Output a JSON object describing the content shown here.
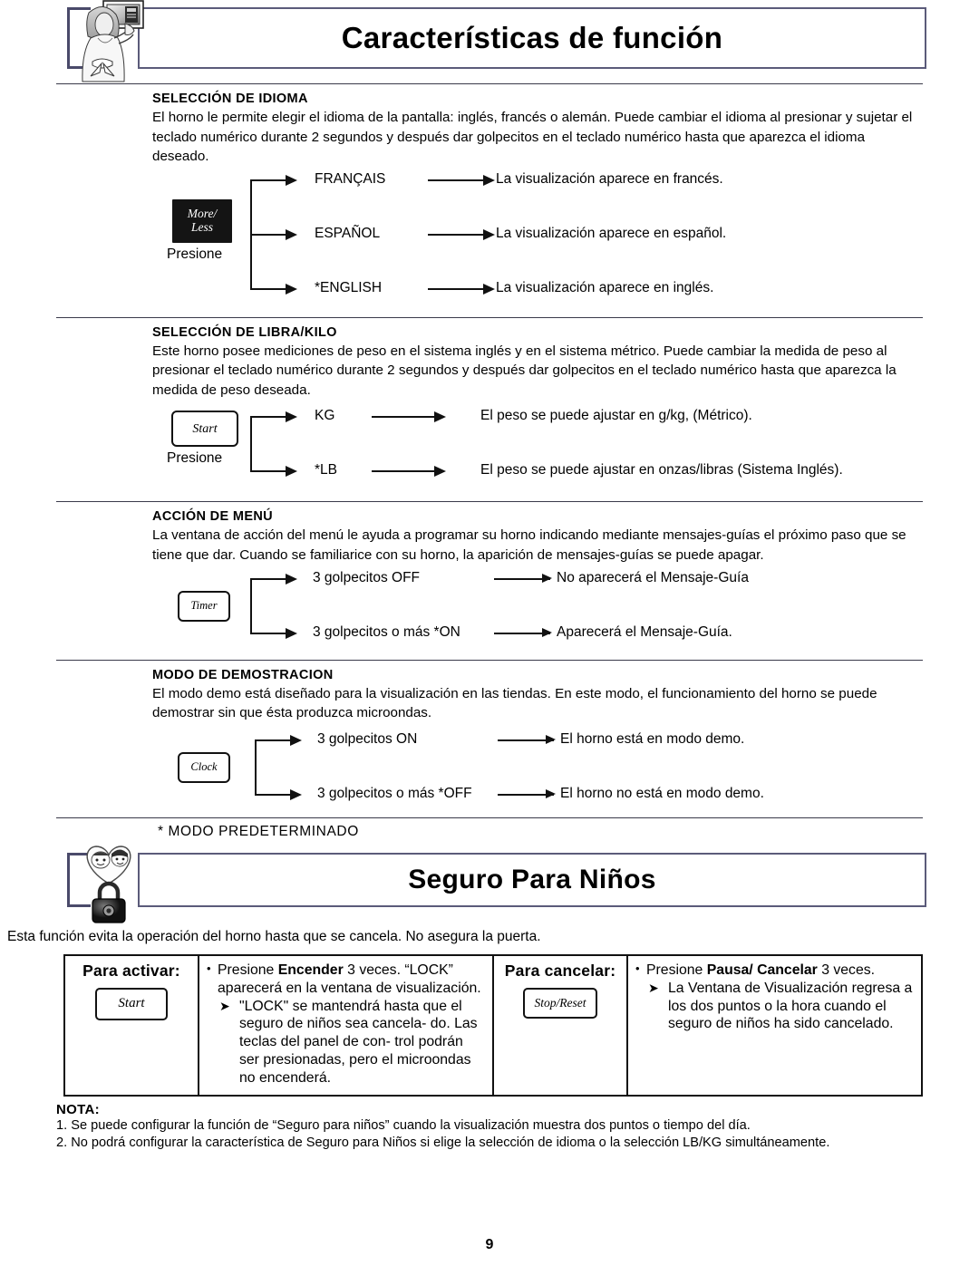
{
  "page": {
    "number": "9"
  },
  "section1": {
    "title": "Características de función",
    "illustration": "woman-with-microwave-illustration",
    "blocks": [
      {
        "heading": "SELECCIÓN DE IDIOMA",
        "paragraph": "El horno le permite elegir el idioma de la pantalla: inglés, francés o alemán. Puede cambiar el idioma al presionar y sujetar el teclado numérico durante 2 segundos y  después dar golpecitos en el teclado numérico hasta que aparezca el idioma deseado.",
        "button": {
          "line1": "More/",
          "line2": "Less",
          "style": "black"
        },
        "button_caption": "Presione",
        "rows": [
          {
            "option": "FRANÇAIS",
            "result": "La visualización aparece en francés."
          },
          {
            "option": "ESPAÑOL",
            "result": "La visualización aparece en español."
          },
          {
            "option": "*ENGLISH",
            "result": "La visualización aparece en inglés."
          }
        ]
      },
      {
        "heading": "SELECCIÓN DE LIBRA/KILO",
        "paragraph": "Este horno posee mediciones de peso en el sistema inglés y en el sistema métrico. Puede cambiar la medida de peso al presionar el teclado numérico durante 2 segundos y después dar golpecitos en el teclado numérico hasta que aparezca la medida de peso deseada.",
        "button": {
          "line1": "Start",
          "line2": "",
          "style": "white"
        },
        "button_caption": "Presione",
        "rows": [
          {
            "option": "KG",
            "result": "El peso se puede ajustar en g/kg, (Métrico)."
          },
          {
            "option": "*LB",
            "result": "El peso se puede ajustar en onzas/libras (Sistema Inglés)."
          }
        ]
      },
      {
        "heading": "ACCIÓN DE MENÚ",
        "paragraph": "La ventana de acción del menú le ayuda a programar su horno indicando mediante mensajes-guías el próximo paso que se tiene que dar. Cuando se familiarice con su horno, la aparición de mensajes-guías se puede apagar.",
        "button": {
          "line1": "Timer",
          "line2": "",
          "style": "white"
        },
        "button_caption": "",
        "rows": [
          {
            "option": "3 golpecitos OFF",
            "result": "No aparecerá el Mensaje-Guía"
          },
          {
            "option": "3 golpecitos o más *ON",
            "result": "Aparecerá el Mensaje-Guía."
          }
        ]
      },
      {
        "heading": "MODO DE DEMOSTRACION",
        "paragraph": "El modo demo está diseñado para la visualización en las tiendas. En este modo, el funcionamiento del horno se puede demostrar sin que ésta produzca microondas.",
        "button": {
          "line1": "Clock",
          "line2": "",
          "style": "white"
        },
        "button_caption": "",
        "rows": [
          {
            "option": "3 golpecitos ON",
            "result": "El horno está en modo demo."
          },
          {
            "option": "3 golpecitos o más *OFF",
            "result": "El horno no está en modo demo."
          }
        ]
      }
    ],
    "footnote": "*  MODO  PREDETERMINADO"
  },
  "section2": {
    "title": "Seguro Para Niños",
    "illustration": "children-heart-padlock-illustration",
    "intro": "Esta función evita la operación del horno hasta que se cancela. No asegura la puerta.",
    "columns": [
      {
        "header": "Para activar:",
        "key_label": "Start",
        "bullet_pre": "Presione ",
        "bullet_bold": "Encender",
        "bullet_post": " 3 veces. “LOCK” aparecerá en la ventana de visualización.",
        "arrow_text": "\"LOCK\" se mantendrá hasta que el seguro de niños sea cancela- do. Las teclas del panel de con- trol podrán ser presionadas, pero el microondas no encenderá."
      },
      {
        "header": "Para cancelar:",
        "key_label": "Stop/Reset",
        "bullet_pre": "Presione  ",
        "bullet_bold": "Pausa/ Cancelar",
        "bullet_post": " 3 veces.",
        "arrow_text": "La Ventana de Visualización regresa a los dos puntos o la hora cuando el seguro de niños ha sido cancelado."
      }
    ],
    "note": {
      "header": "NOTA:",
      "items": [
        "1. Se puede configurar la función de “Seguro para niños” cuando la visualización muestra dos puntos o tiempo del día.",
        "2. No podrá configurar la característica de Seguro para Niños si elige la selección de idioma o la selección LB/KG simultáneamente."
      ]
    }
  }
}
